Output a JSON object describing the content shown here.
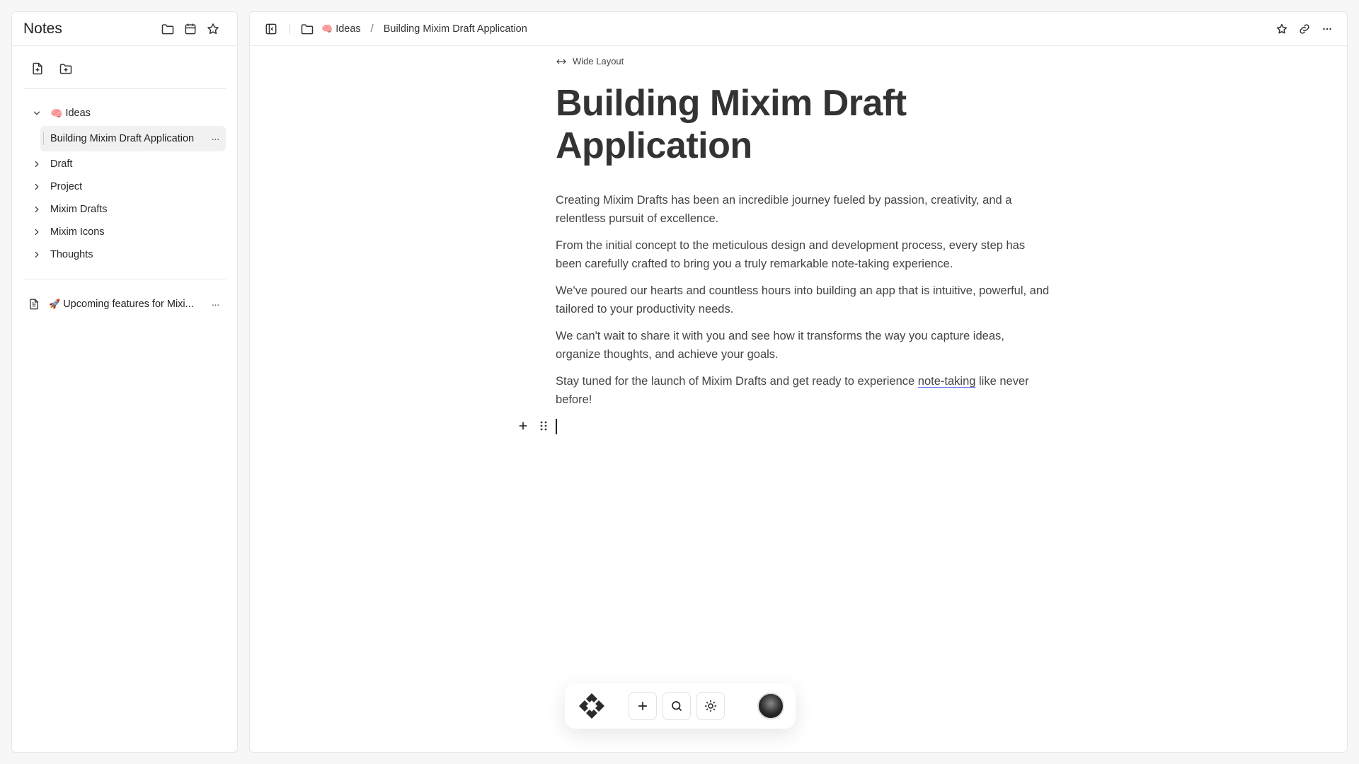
{
  "sidebar": {
    "title": "Notes",
    "tree": {
      "folder_emoji": "🧠",
      "folder_label": "Ideas",
      "child_label": "Building Mixim Draft Application",
      "folders": [
        "Draft",
        "Project",
        "Mixim Drafts",
        "Mixim Icons",
        "Thoughts"
      ]
    },
    "doc": {
      "emoji": "🚀",
      "label": "Upcoming features for Mixi..."
    },
    "more_glyph": "···"
  },
  "header": {
    "breadcrumb_emoji": "🧠",
    "breadcrumb_folder": "Ideas",
    "breadcrumb_sep": "/",
    "breadcrumb_page": "Building Mixim Draft Application"
  },
  "document": {
    "wide_layout_label": "Wide Layout",
    "title": "Building Mixim Draft Application",
    "paragraphs": [
      "Creating Mixim Drafts has been an incredible journey fueled by passion, creativity, and a relentless pursuit of excellence.",
      "From the initial concept to the meticulous design and development process, every step has been carefully crafted to bring you a truly remarkable note-taking experience.",
      "We've poured our hearts and countless hours into building an app that is intuitive, powerful, and tailored to your productivity needs.",
      "We can't wait to share it with you and see how it transforms the way you capture ideas, organize thoughts, and achieve your goals."
    ],
    "last_para_before": "Stay tuned for the launch of Mixim Drafts and get ready to experience ",
    "last_para_link": "note-taking",
    "last_para_after": " like never before!"
  },
  "colors": {
    "accent_underline": "#5b6cff",
    "title": "#333333"
  }
}
